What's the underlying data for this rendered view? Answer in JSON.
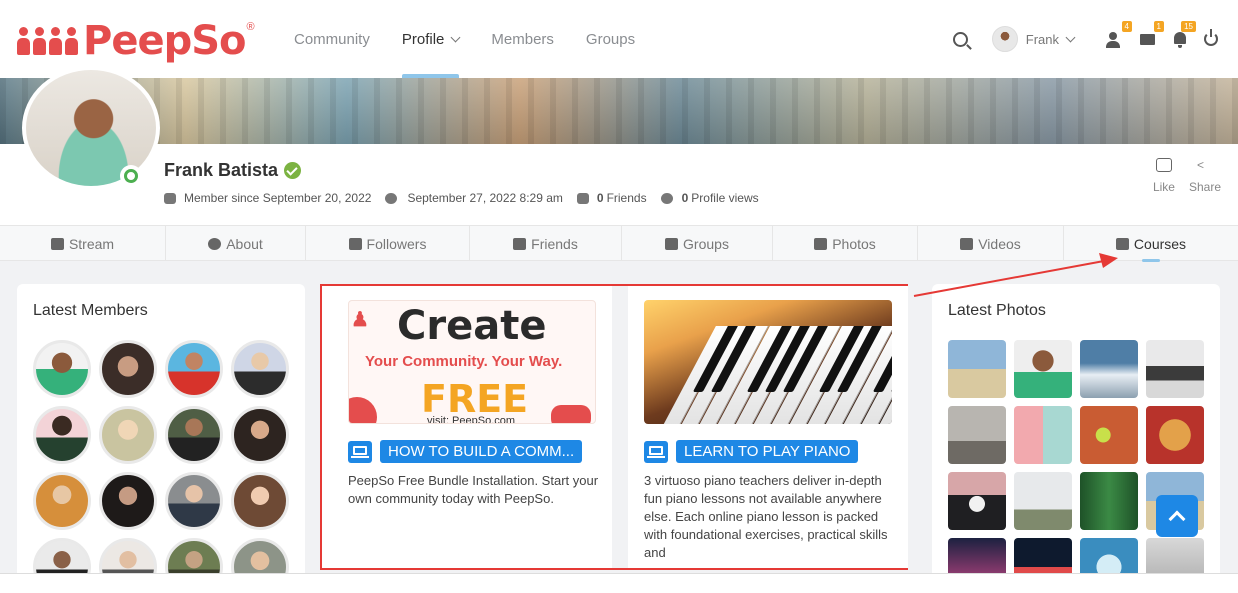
{
  "brand": {
    "name": "PeepSo",
    "reg": "®"
  },
  "menu": [
    {
      "label": "Community"
    },
    {
      "label": "Profile"
    },
    {
      "label": "Members"
    },
    {
      "label": "Groups"
    }
  ],
  "user": {
    "name": "Frank"
  },
  "badges": {
    "friends": "4",
    "messages": "1",
    "notifications": "15"
  },
  "profile": {
    "name": "Frank Batista",
    "member_since": "Member since September 20, 2022",
    "last_seen": "September 27, 2022 8:29 am",
    "friends_count": "0",
    "friends_label": "Friends",
    "views_count": "0",
    "views_label": "Profile views",
    "like_label": "Like",
    "share_label": "Share"
  },
  "tabs": [
    {
      "label": "Stream"
    },
    {
      "label": "About"
    },
    {
      "label": "Followers"
    },
    {
      "label": "Friends"
    },
    {
      "label": "Groups"
    },
    {
      "label": "Photos"
    },
    {
      "label": "Videos"
    },
    {
      "label": "Courses"
    }
  ],
  "latest_members": {
    "title": "Latest Members"
  },
  "latest_photos": {
    "title": "Latest Photos"
  },
  "courses": [
    {
      "title": "HOW TO BUILD A COMM...",
      "desc": "PeepSo Free Bundle Installation. Start your own community today with PeepSo.",
      "thumb": {
        "heading": "Create",
        "tagline": "Your Community. Your Way.",
        "price": "FREE",
        "url": "visit: PeepSo.com"
      }
    },
    {
      "title": "LEARN TO PLAY PIANO",
      "desc": "3 virtuoso piano teachers deliver in-depth fun piano lessons not available anywhere else. Each online piano lesson is packed with foundational exercises, practical skills and"
    }
  ],
  "colors": {
    "brand": "#e44d4d",
    "accent": "#1e88e5",
    "highlight": "#e53935",
    "badge": "#f4a523"
  }
}
